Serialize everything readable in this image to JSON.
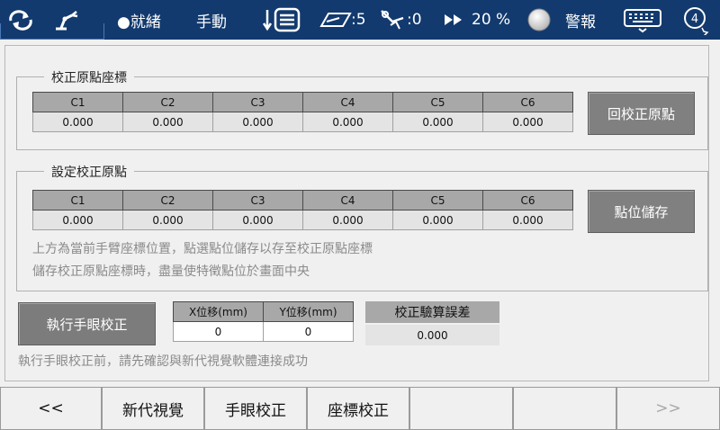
{
  "topbar": {
    "status": "●就緒",
    "mode": "手動",
    "tool_count": ":5",
    "user_count": ":0",
    "speed": "20 %",
    "alarm": "警報",
    "help_badge": "4"
  },
  "calib_origin": {
    "title": "校正原點座標",
    "headers": [
      "C1",
      "C2",
      "C3",
      "C4",
      "C5",
      "C6"
    ],
    "values": [
      "0.000",
      "0.000",
      "0.000",
      "0.000",
      "0.000",
      "0.000"
    ],
    "button": "回校正原點"
  },
  "set_origin": {
    "title": "設定校正原點",
    "headers": [
      "C1",
      "C2",
      "C3",
      "C4",
      "C5",
      "C6"
    ],
    "values": [
      "0.000",
      "0.000",
      "0.000",
      "0.000",
      "0.000",
      "0.000"
    ],
    "button": "點位儲存",
    "hint1": "上方為當前手臂座標位置，點選點位儲存以存至校正原點座標",
    "hint2": "儲存校正原點座標時，盡量使特徵點位於畫面中央"
  },
  "hand_eye": {
    "button": "執行手眼校正",
    "x_label": "X位移(mm)",
    "y_label": "Y位移(mm)",
    "x_value": "0",
    "y_value": "0",
    "error_label": "校正驗算誤差",
    "error_value": "0.000",
    "hint": "執行手眼校正前，請先確認與新代視覺軟體連接成功"
  },
  "bottombar": {
    "prev": "<<",
    "tab1": "新代視覺",
    "tab2": "手眼校正",
    "tab3": "座標校正",
    "next": ">>"
  }
}
